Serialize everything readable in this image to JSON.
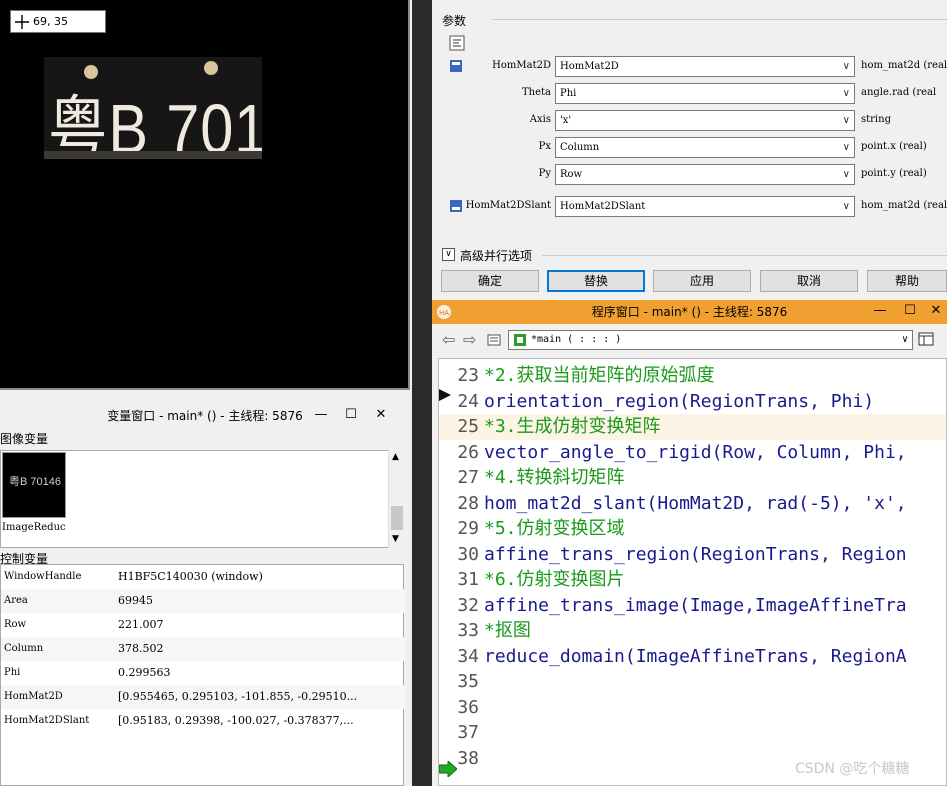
{
  "graphics": {
    "coordinate_readout": "69, 35",
    "plate_text": "粤B 70146"
  },
  "variable_window": {
    "title": "变量窗口 - main* () - 主线程: 5876",
    "image_section_label": "图像变量",
    "image_vars": [
      {
        "name": "ImageReduc",
        "thumb_text": "粤B 70146"
      }
    ],
    "control_section_label": "控制变量",
    "control_vars": [
      {
        "name": "WindowHandle",
        "value": "H1BF5C140030 (window)"
      },
      {
        "name": "Area",
        "value": "69945"
      },
      {
        "name": "Row",
        "value": "221.007"
      },
      {
        "name": "Column",
        "value": "378.502"
      },
      {
        "name": "Phi",
        "value": "0.299563"
      },
      {
        "name": "HomMat2D",
        "value": "[0.955465, 0.295103, -101.855, -0.29510..."
      },
      {
        "name": "HomMat2DSlant",
        "value": "[0.95183, 0.29398, -100.027, -0.378377,..."
      }
    ]
  },
  "operator_dialog": {
    "params_label": "参数",
    "params": [
      {
        "label": "HomMat2D",
        "value": "HomMat2D",
        "type": "hom_mat2d (real",
        "icon": "input-matrix-icon"
      },
      {
        "label": "Theta",
        "value": "Phi",
        "type": "angle.rad (real"
      },
      {
        "label": "Axis",
        "value": "'x'",
        "type": "string"
      },
      {
        "label": "Px",
        "value": "Column",
        "type": "point.x (real)"
      },
      {
        "label": "Py",
        "value": "Row",
        "type": "point.y (real)"
      },
      {
        "label": "HomMat2DSlant",
        "value": "HomMat2DSlant",
        "type": "hom_mat2d (real",
        "icon": "output-matrix-icon"
      }
    ],
    "advanced_label": "高级并行选项",
    "buttons": {
      "ok": "确定",
      "replace": "替换",
      "apply": "应用",
      "cancel": "取消",
      "help": "帮助"
    }
  },
  "program_window": {
    "title": "程序窗口 - main* () - 主线程: 5876",
    "procedure": "*main ( : : : )",
    "lines": [
      {
        "num": "23",
        "text": "*2.获取当前矩阵的原始弧度",
        "kind": "comment"
      },
      {
        "num": "24",
        "text": "orientation_region(RegionTrans, Phi)",
        "kind": "stmt"
      },
      {
        "num": "25",
        "text": "*3.生成仿射变换矩阵",
        "kind": "comment"
      },
      {
        "num": "26",
        "text": "vector_angle_to_rigid(Row, Column, Phi,",
        "kind": "stmt"
      },
      {
        "num": "27",
        "text": "*4.转换斜切矩阵",
        "kind": "comment"
      },
      {
        "num": "28",
        "text": "hom_mat2d_slant(HomMat2D, rad(-5), 'x',",
        "kind": "stmt"
      },
      {
        "num": "29",
        "text": "*5.仿射变换区域",
        "kind": "comment"
      },
      {
        "num": "30",
        "text": "affine_trans_region(RegionTrans, Region",
        "kind": "stmt"
      },
      {
        "num": "31",
        "text": "*6.仿射变换图片",
        "kind": "comment"
      },
      {
        "num": "32",
        "text": "affine_trans_image(Image,ImageAffineTra",
        "kind": "stmt"
      },
      {
        "num": "33",
        "text": "*抠图",
        "kind": "comment"
      },
      {
        "num": "34",
        "text": "reduce_domain(ImageAffineTrans, RegionA",
        "kind": "stmt"
      },
      {
        "num": "35",
        "text": "",
        "kind": "stmt"
      },
      {
        "num": "36",
        "text": "",
        "kind": "stmt"
      },
      {
        "num": "37",
        "text": "",
        "kind": "stmt"
      },
      {
        "num": "38",
        "text": "",
        "kind": "stmt"
      }
    ]
  },
  "watermark": "CSDN @吃个糖糖",
  "colors": {
    "comment": "#1a9a1a",
    "statement": "#1a1a8c",
    "program_title_bar": "#f0a030"
  }
}
